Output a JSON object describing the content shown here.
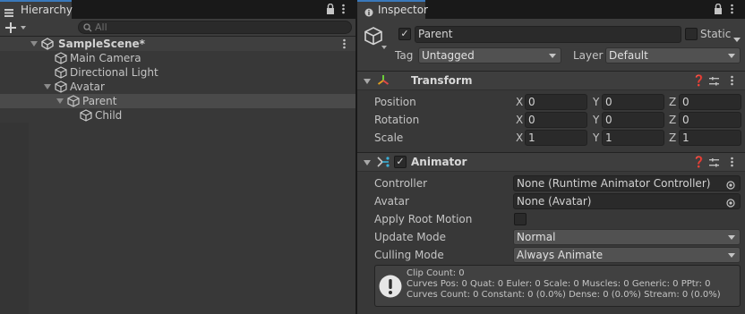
{
  "hierarchy": {
    "tab_title": "Hierarchy",
    "search_placeholder": "All",
    "scene": "SampleScene*",
    "items": [
      "Main Camera",
      "Directional Light",
      "Avatar",
      "Parent",
      "Child"
    ]
  },
  "inspector": {
    "tab_title": "Inspector",
    "object_name": "Parent",
    "static_label": "Static",
    "tag_label": "Tag",
    "tag_value": "Untagged",
    "layer_label": "Layer",
    "layer_value": "Default",
    "transform": {
      "title": "Transform",
      "rows": [
        {
          "label": "Position",
          "x": "0",
          "y": "0",
          "z": "0"
        },
        {
          "label": "Rotation",
          "x": "0",
          "y": "0",
          "z": "0"
        },
        {
          "label": "Scale",
          "x": "1",
          "y": "1",
          "z": "1"
        }
      ],
      "axes": [
        "X",
        "Y",
        "Z"
      ]
    },
    "animator": {
      "title": "Animator",
      "controller_label": "Controller",
      "controller_value": "None (Runtime Animator Controller)",
      "avatar_label": "Avatar",
      "avatar_value": "None (Avatar)",
      "apply_root_motion_label": "Apply Root Motion",
      "update_mode_label": "Update Mode",
      "update_mode_value": "Normal",
      "culling_mode_label": "Culling Mode",
      "culling_mode_value": "Always Animate",
      "info_lines": [
        "Clip Count: 0",
        "Curves Pos: 0 Quat: 0 Euler: 0 Scale: 0 Muscles: 0 Generic: 0 PPtr: 0",
        "Curves Count: 0 Constant: 0 (0.0%) Dense: 0 (0.0%) Stream: 0 (0.0%)"
      ]
    }
  },
  "colors": {
    "accent": "#3a79bb",
    "panel": "#383838",
    "field": "#2a2a2a"
  },
  "icons": [
    "lock-icon",
    "kebab-menu-icon",
    "plus-icon",
    "search-icon",
    "cube-icon",
    "unity-scene-icon",
    "help-icon",
    "presets-icon",
    "object-picker-icon",
    "warning-icon",
    "transform-icon",
    "animator-icon"
  ]
}
